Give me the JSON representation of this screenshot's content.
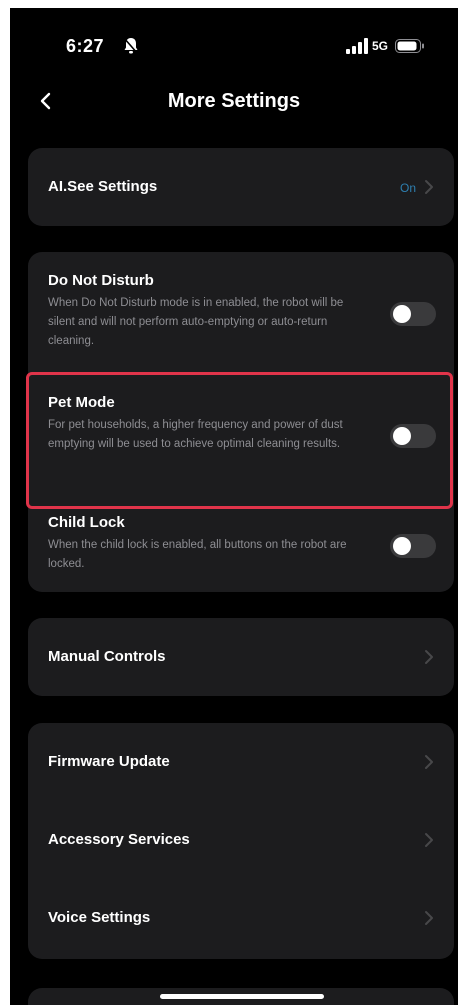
{
  "status_bar": {
    "time": "6:27",
    "network": "5G"
  },
  "header": {
    "title": "More Settings"
  },
  "ai_see": {
    "label": "AI.See Settings",
    "value": "On"
  },
  "toggles": {
    "do_not_disturb": {
      "title": "Do Not Disturb",
      "description": "When Do Not Disturb mode is in enabled, the robot will be silent and will not perform auto-emptying or auto-return cleaning.",
      "enabled": false
    },
    "pet_mode": {
      "title": "Pet Mode",
      "description": "For pet households, a higher frequency and power of dust emptying will be used to achieve optimal cleaning results.",
      "enabled": false
    },
    "child_lock": {
      "title": "Child Lock",
      "description": "When the child lock is enabled, all buttons on the robot are locked.",
      "enabled": false
    }
  },
  "manual_controls": {
    "label": "Manual Controls"
  },
  "system_group": {
    "firmware": "Firmware Update",
    "accessory": "Accessory Services",
    "voice": "Voice Settings"
  },
  "colors": {
    "background": "#000000",
    "card": "#1c1c1e",
    "highlight": "#e0344a",
    "accent": "#2e7fb0"
  }
}
